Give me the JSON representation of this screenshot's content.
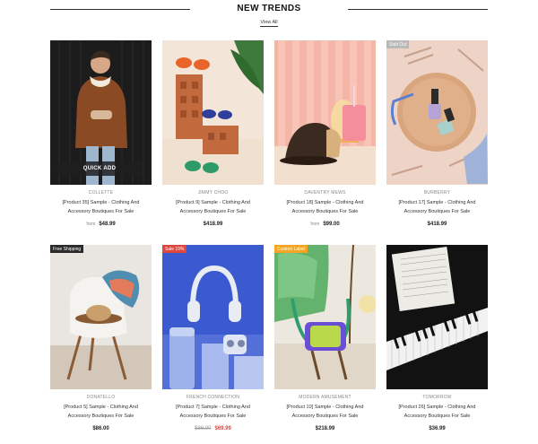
{
  "section": {
    "title": "NEW TRENDS",
    "view_all": "View All"
  },
  "quick_add_label": "QUICK ADD",
  "products": [
    {
      "vendor": "COLLETTE",
      "name_line1": "[Product 35] Sample - Clothing And",
      "name_line2": "Accessory Boutiques For Sale",
      "from_label": "from",
      "price": "$48.99"
    },
    {
      "vendor": "JIMMY CHOO",
      "name_line1": "[Product 9] Sample - Clothing And",
      "name_line2": "Accessory Boutiques For Sale",
      "price": "$418.99"
    },
    {
      "vendor": "DAVENTRY MEWS",
      "name_line1": "[Product 18] Sample - Clothing And",
      "name_line2": "Accessory Boutiques For Sale",
      "from_label": "from",
      "price": "$99.00"
    },
    {
      "vendor": "BURBERRY",
      "badge": "Sold Out",
      "name_line1": "[Product 17] Sample - Clothing And",
      "name_line2": "Accessory Boutiques For Sale",
      "price": "$418.99"
    },
    {
      "vendor": "DONATELLO",
      "badge": "Free Shipping",
      "name_line1": "[Product 5] Sample - Clothing And",
      "name_line2": "Accessory Boutiques For Sale",
      "price": "$86.00"
    },
    {
      "vendor": "FRENCH CONNECTION",
      "badge": "Sale 19%",
      "name_line1": "[Product 7] Sample - Clothing And",
      "name_line2": "Accessory Boutiques For Sale",
      "compare_price": "$86.00",
      "price": "$69.99"
    },
    {
      "vendor": "MODERN AMUSEMENT",
      "badge": "Custom Label",
      "name_line1": "[Product 10] Sample - Clothing And",
      "name_line2": "Accessory Boutiques For Sale",
      "price": "$218.99"
    },
    {
      "vendor": "TOMORROW",
      "name_line1": "[Product 26] Sample - Clothing And",
      "name_line2": "Accessory Boutiques For Sale",
      "price": "$36.99"
    }
  ],
  "colors": {
    "badge_sold_out": "#b9b9b9",
    "badge_free_shipping": "#2b2b2b",
    "badge_sale": "#e0453e",
    "badge_custom": "#f3a623",
    "sale_price": "#e0453e"
  }
}
